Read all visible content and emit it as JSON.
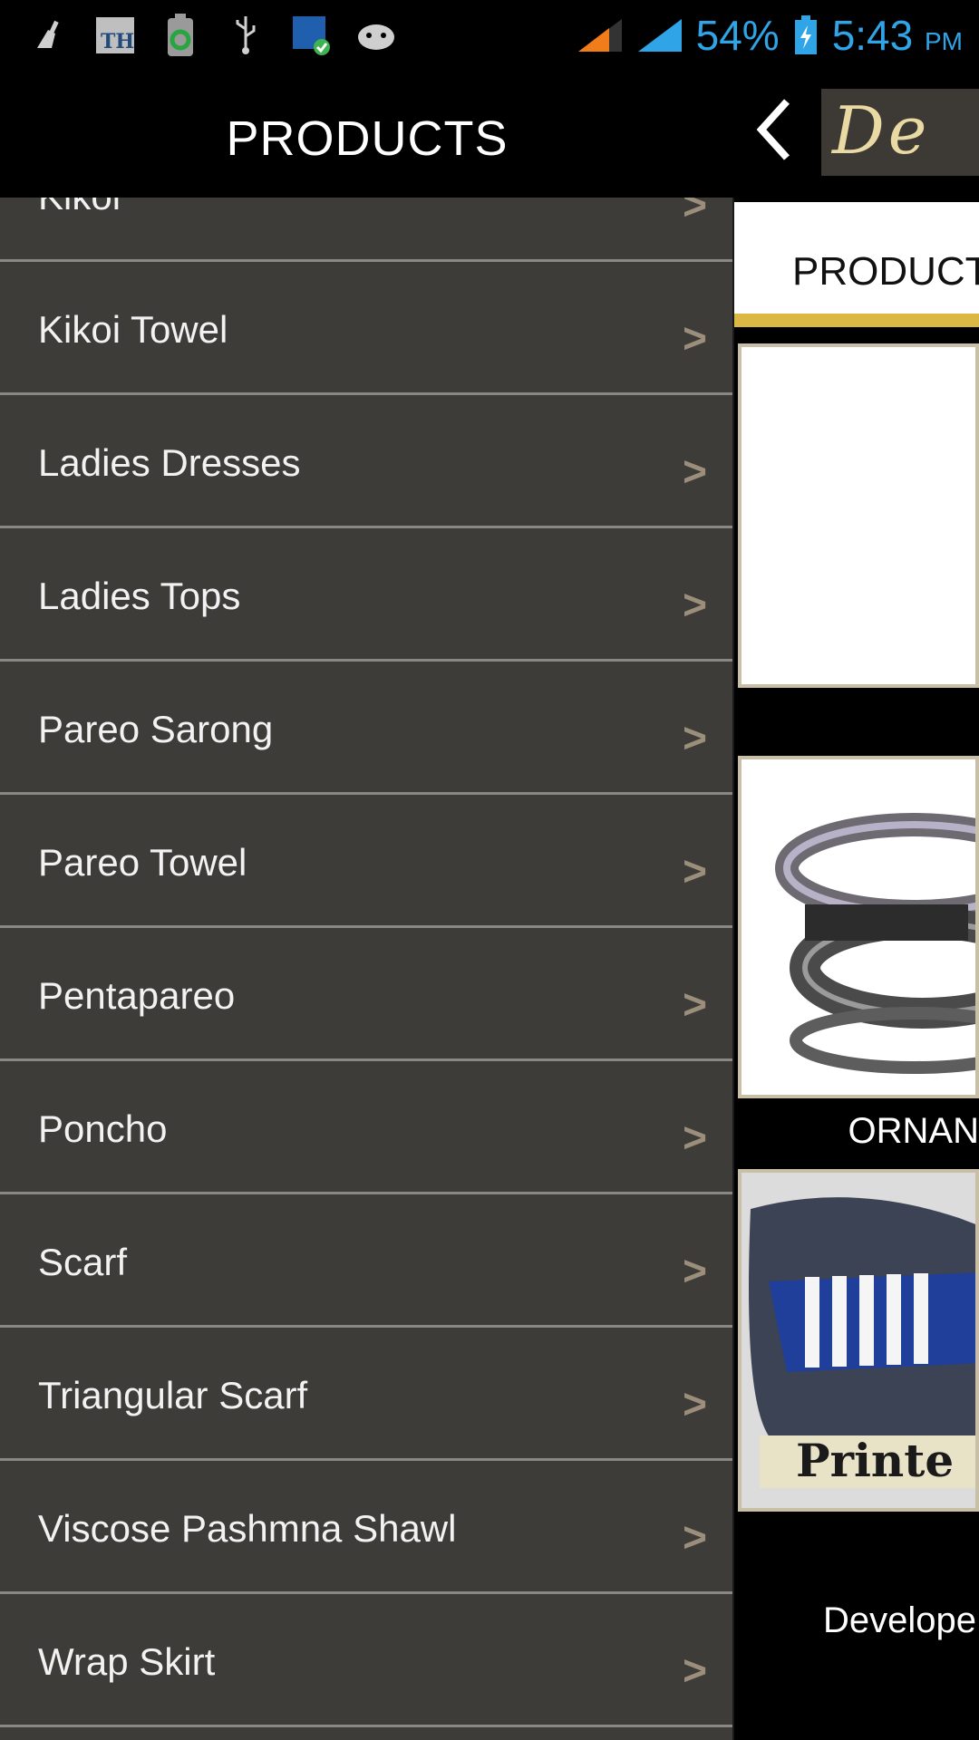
{
  "status_bar": {
    "icons": [
      "cleaner-icon",
      "th-app-icon",
      "battery-saver-icon",
      "usb-icon",
      "security-shield-icon",
      "android-debug-icon"
    ],
    "battery_percent": "54%",
    "time": "5:43",
    "ampm": "PM"
  },
  "drawer": {
    "title": "PRODUCTS",
    "items": [
      {
        "label": "Kikoi",
        "arrow": ">"
      },
      {
        "label": "Kikoi Towel",
        "arrow": ">"
      },
      {
        "label": "Ladies Dresses",
        "arrow": ">"
      },
      {
        "label": "Ladies Tops",
        "arrow": ">"
      },
      {
        "label": "Pareo Sarong",
        "arrow": ">"
      },
      {
        "label": "Pareo Towel",
        "arrow": ">"
      },
      {
        "label": "Pentapareo",
        "arrow": ">"
      },
      {
        "label": "Poncho",
        "arrow": ">"
      },
      {
        "label": "Scarf",
        "arrow": ">"
      },
      {
        "label": "Triangular Scarf",
        "arrow": ">"
      },
      {
        "label": "Viscose Pashmna Shawl",
        "arrow": ">"
      },
      {
        "label": "Wrap Skirt",
        "arrow": ">"
      }
    ]
  },
  "main": {
    "logo_text": "De",
    "tab_label": "PRODUCT",
    "card2_caption": "ORNAN",
    "card3_overlay": "Printe",
    "footer": "Develope",
    "colors": {
      "accent_gold": "#dbb743",
      "drawer_bg": "#3e3c39",
      "status_blue": "#2fa4e7"
    }
  }
}
